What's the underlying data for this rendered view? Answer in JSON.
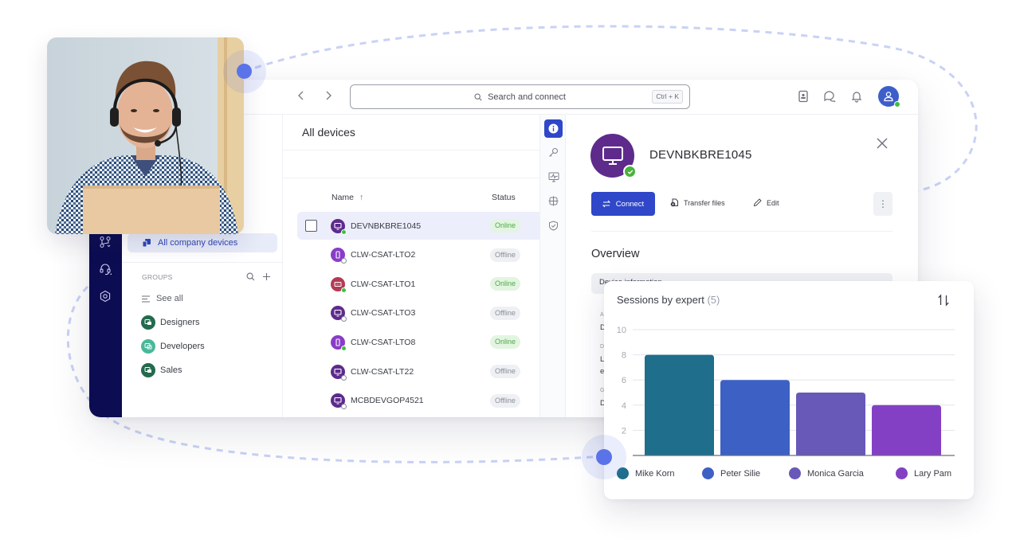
{
  "topbar": {
    "back_icon": "chevron-left-icon",
    "forward_icon": "chevron-right-icon",
    "search_placeholder": "Search and connect",
    "search_shortcut": "Ctrl + K",
    "icons": [
      "contact-book-icon",
      "chat-icon",
      "bell-icon",
      "user-avatar-icon"
    ],
    "user_status": "online"
  },
  "rail": {
    "icons": [
      "connections-icon",
      "support-headset-icon",
      "settings-hex-icon"
    ]
  },
  "groups_panel": {
    "active_item": "All company devices",
    "groups_label": "GROUPS",
    "see_all": "See all",
    "groups": [
      {
        "name": "Designers",
        "color": "#236b4e"
      },
      {
        "name": "Developers",
        "color": "#49b89a"
      },
      {
        "name": "Sales",
        "color": "#236b4e"
      }
    ]
  },
  "devices": {
    "title": "All devices",
    "columns": {
      "name": "Name",
      "sort": "↑",
      "status": "Status"
    },
    "rows": [
      {
        "name": "DEVNBKBRE1045",
        "status": "Online",
        "type": "desktop",
        "icon_color": "#5e2b8c",
        "selected": true
      },
      {
        "name": "CLW-CSAT-LTO2",
        "status": "Offline",
        "type": "mobile",
        "icon_color": "#8a3cc9",
        "selected": false
      },
      {
        "name": "CLW-CSAT-LTO1",
        "status": "Online",
        "type": "server",
        "icon_color": "#b33a55",
        "selected": false
      },
      {
        "name": "CLW-CSAT-LTO3",
        "status": "Offline",
        "type": "desktop",
        "icon_color": "#5e2b8c",
        "selected": false
      },
      {
        "name": "CLW-CSAT-LTO8",
        "status": "Online",
        "type": "mobile",
        "icon_color": "#8a3cc9",
        "selected": false
      },
      {
        "name": "CLW-CSAT-LT22",
        "status": "Offline",
        "type": "desktop",
        "icon_color": "#5e2b8c",
        "selected": false
      },
      {
        "name": "MCBDEVGOP4521",
        "status": "Offline",
        "type": "desktop",
        "icon_color": "#5e2b8c",
        "selected": false
      }
    ]
  },
  "vtabs": [
    "info-icon",
    "key-icon",
    "monitor-activity-icon",
    "network-globe-icon",
    "shield-check-icon"
  ],
  "detail": {
    "device_name": "DEVNBKBRE1045",
    "connect_label": "Connect",
    "transfer_label": "Transfer files",
    "edit_label": "Edit",
    "overview_title": "Overview",
    "section_label": "Device information",
    "fragments": [
      "A",
      "D",
      "D",
      "L",
      "e",
      "G",
      "D"
    ]
  },
  "chart_card": {
    "title": "Sessions by expert",
    "count": "(5)"
  },
  "chart_data": {
    "type": "bar",
    "title": "Sessions by expert (5)",
    "categories": [
      "Mike Korn",
      "Peter Silie",
      "Monica Garcia",
      "Lary Pam"
    ],
    "values": [
      8,
      6,
      5,
      4
    ],
    "colors": [
      "#1e6e8c",
      "#3d60c4",
      "#6858b8",
      "#8440c4"
    ],
    "xlabel": "",
    "ylabel": "",
    "ylim": [
      0,
      10
    ],
    "yticks": [
      2,
      4,
      6,
      8,
      10
    ],
    "grid": true,
    "legend": "bottom"
  },
  "colors": {
    "accent": "#2f47c8",
    "rail": "#0c0c52",
    "online_text": "#4fa84a",
    "online_bg": "#e3f5e1",
    "offline_text": "#8a8e98",
    "offline_bg": "#eef0f3",
    "node": "#5b73e8"
  }
}
